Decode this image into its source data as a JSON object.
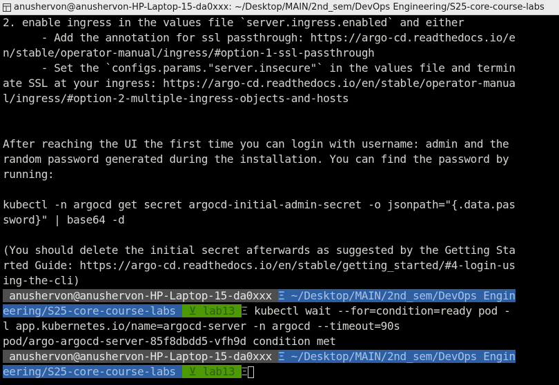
{
  "window": {
    "title": "anushervon@anushervon-HP-Laptop-15-da0xxx: ~/Desktop/MAIN/2nd_sem/DevOps Engineering/S25-core-course-labs",
    "icon": "terminal-icon"
  },
  "terminal": {
    "output_lines": [
      "2. enable ingress in the values file `server.ingress.enabled` and either",
      "      - Add the annotation for ssl passthrough: https://argo-cd.readthedocs.io/e",
      "n/stable/operator-manual/ingress/#option-1-ssl-passthrough",
      "      - Set the `configs.params.\"server.insecure\"` in the values file and termin",
      "ate SSL at your ingress: https://argo-cd.readthedocs.io/en/stable/operator-manua",
      "l/ingress/#option-2-multiple-ingress-objects-and-hosts",
      "",
      "",
      "After reaching the UI the first time you can login with username: admin and the",
      "random password generated during the installation. You can find the password by",
      "running:",
      "",
      "kubectl -n argocd get secret argocd-initial-admin-secret -o jsonpath=\"{.data.pas",
      "sword}\" | base64 -d",
      "",
      "(You should delete the initial secret afterwards as suggested by the Getting Sta",
      "rted Guide: https://argo-cd.readthedocs.io/en/stable/getting_started/#4-login-us",
      "ing-the-cli)"
    ],
    "prompt1": {
      "user": " anushervon@anushervon-HP-Laptop-15-da0xxx ",
      "sep": "Ξ",
      "path_line1": " ~/Desktop/MAIN/2nd_sem/DevOps Engin",
      "path_line2": "eering/S25-core-course-labs ",
      "git": " ⊻ lab13 ",
      "end_sep": "Ξ",
      "command_line1": " kubectl wait --for=condition=ready pod -",
      "command_line2": "l app.kubernetes.io/name=argocd-server -n argocd --timeout=90s"
    },
    "command_output": "pod/argo-argocd-server-85f8dbdd5-vfh9d condition met",
    "prompt2": {
      "user": " anushervon@anushervon-HP-Laptop-15-da0xxx ",
      "sep": "Ξ",
      "path_line1": " ~/Desktop/MAIN/2nd_sem/DevOps Engin",
      "path_line2": "eering/S25-core-course-labs ",
      "git": " ⊻ lab13 ",
      "end_sep": "Ξ"
    }
  }
}
